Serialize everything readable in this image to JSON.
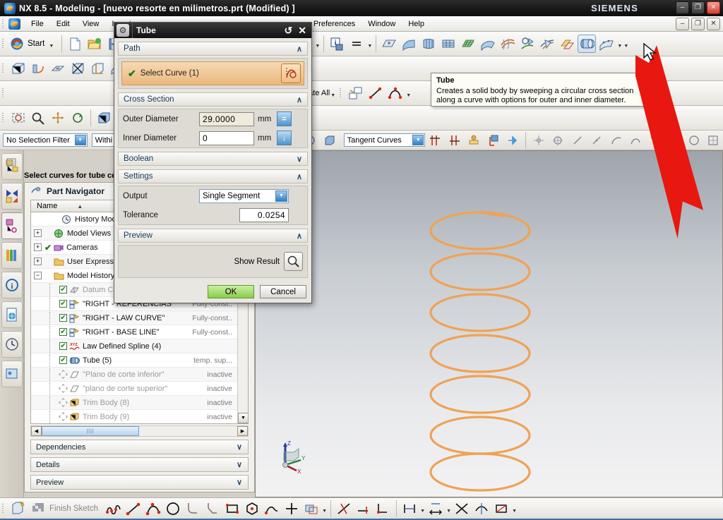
{
  "window": {
    "title": "NX 8.5 - Modeling - [nuevo resorte en milimetros.prt (Modified) ]",
    "brand": "SIEMENS",
    "minimize": "–",
    "restore": "❐",
    "close": "✕",
    "inner_minimize": "–",
    "inner_restore": "❐",
    "inner_close": "✕"
  },
  "menubar": {
    "items": [
      {
        "label": "File"
      },
      {
        "label": "Edit"
      },
      {
        "label": "View"
      },
      {
        "label": "Insert"
      },
      {
        "label": "Preferences"
      },
      {
        "label": "Window"
      },
      {
        "label": "Help"
      }
    ]
  },
  "toolbar": {
    "start_label": "Start",
    "update_all_label": "Update All"
  },
  "selection_bar": {
    "filter_value": "No Selection Filter",
    "within_value": "Withi",
    "curve_rule_value": "Tangent Curves"
  },
  "cue": {
    "text": "Select curves for tube cente"
  },
  "part_navigator": {
    "title": "Part Navigator",
    "column_name": "Name",
    "sort_indicator": "▲",
    "rows": [
      {
        "name": "History Mode",
        "status": "",
        "check": "none",
        "expander": "",
        "depth": 1,
        "icon": "clock-icon",
        "dim": false
      },
      {
        "name": "Model Views",
        "status": "",
        "check": "none",
        "expander": "+",
        "depth": 0,
        "icon": "views-icon",
        "dim": false
      },
      {
        "name": "Cameras",
        "status": "",
        "check": "check",
        "expander": "+",
        "depth": 0,
        "icon": "camera-icon",
        "dim": false
      },
      {
        "name": "User Expression",
        "status": "",
        "check": "none",
        "expander": "+",
        "depth": 0,
        "icon": "folder-icon",
        "dim": false
      },
      {
        "name": "Model History",
        "status": "",
        "check": "none",
        "expander": "−",
        "depth": 0,
        "icon": "folder-icon",
        "dim": false
      },
      {
        "name": "Datum C",
        "status": "",
        "check": "box",
        "expander": "",
        "depth": 2,
        "icon": "datum-icon",
        "dim": true
      },
      {
        "name": "\"RIGHT - REFERENCIAS\"",
        "status": "Fully-const..",
        "check": "box",
        "expander": "",
        "depth": 2,
        "icon": "sketch-icon",
        "dim": false
      },
      {
        "name": "\"RIGHT - LAW CURVE\"",
        "status": "Fully-const..",
        "check": "box",
        "expander": "",
        "depth": 2,
        "icon": "sketch-icon",
        "dim": false
      },
      {
        "name": "\"RIGHT - BASE LINE\"",
        "status": "Fully-const..",
        "check": "box",
        "expander": "",
        "depth": 2,
        "icon": "sketch-icon",
        "dim": false
      },
      {
        "name": "Law Defined Spline (4)",
        "status": "",
        "check": "box",
        "expander": "",
        "depth": 2,
        "icon": "spline-icon",
        "dim": false
      },
      {
        "name": "Tube (5)",
        "status": "temp. sup...",
        "check": "box",
        "expander": "",
        "depth": 2,
        "icon": "tube-icon",
        "dim": false
      },
      {
        "name": "\"Plano de corte inferior\"",
        "status": "inactive",
        "check": "diamond",
        "expander": "",
        "depth": 2,
        "icon": "plane-icon",
        "dim": true
      },
      {
        "name": "\"plano de corte superior\"",
        "status": "inactive",
        "check": "diamond",
        "expander": "",
        "depth": 2,
        "icon": "plane-icon",
        "dim": true
      },
      {
        "name": "Trim Body (8)",
        "status": "inactive",
        "check": "diamond",
        "expander": "",
        "depth": 2,
        "icon": "body-icon",
        "dim": true
      },
      {
        "name": "Trim Body (9)",
        "status": "inactive",
        "check": "diamond",
        "expander": "",
        "depth": 2,
        "icon": "body-icon",
        "dim": true
      }
    ],
    "sections": [
      {
        "label": "Dependencies",
        "chev": "∨"
      },
      {
        "label": "Details",
        "chev": "∨"
      },
      {
        "label": "Preview",
        "chev": "∨"
      }
    ]
  },
  "dialog": {
    "title": "Tube",
    "reset_glyph": "↺",
    "close_glyph": "✕",
    "sections": {
      "path": {
        "label": "Path",
        "chev": "∧"
      },
      "cross_section": {
        "label": "Cross Section",
        "chev": "∧"
      },
      "boolean": {
        "label": "Boolean",
        "chev": "∨"
      },
      "settings": {
        "label": "Settings",
        "chev": "∧"
      },
      "preview": {
        "label": "Preview",
        "chev": "∧"
      }
    },
    "select_curve": {
      "label": "Select Curve (1)",
      "check": "✔"
    },
    "outer_diameter": {
      "label": "Outer Diameter",
      "value": "29.0000",
      "unit": "mm",
      "btn": "="
    },
    "inner_diameter": {
      "label": "Inner Diameter",
      "value": "0",
      "unit": "mm",
      "btn": "↓"
    },
    "output": {
      "label": "Output",
      "value": "Single Segment"
    },
    "tolerance": {
      "label": "Tolerance",
      "value": "0.0254"
    },
    "show_result": {
      "label": "Show Result"
    },
    "ok_label": "OK",
    "cancel_label": "Cancel"
  },
  "tooltip": {
    "title": "Tube",
    "body": "Creates a solid body by sweeping a circular cross section along a curve with options for outer and inner diameter."
  },
  "bottom_bar": {
    "finish_sketch_label": "Finish Sketch"
  },
  "graphics": {
    "triad": {
      "z": "Z",
      "y": "Y",
      "x": "X"
    },
    "spring_color": "#f0a254",
    "background_top": "#9ea4ab",
    "background_bottom": "#f2f2f3"
  },
  "colors": {
    "accent_blue": "#2f7fc4",
    "highlight_orange": "#e9b87c",
    "ok_green": "#89cc4e",
    "annotation_red": "#e8170f"
  }
}
